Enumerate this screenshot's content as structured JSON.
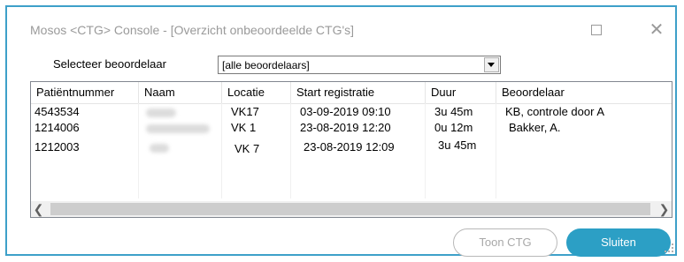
{
  "window": {
    "title": "Mosos <CTG> Console - [Overzicht onbeoordeelde CTG's]"
  },
  "filter": {
    "label": "Selecteer beoordelaar",
    "selected": "[alle beoordelaars]"
  },
  "table": {
    "columns": [
      "Patiëntnummer",
      "Naam",
      "Locatie",
      "Start registratie",
      "Duur",
      "Beoordelaar"
    ],
    "rows": [
      {
        "patient": "4543534",
        "location": "VK17",
        "start": "03-09-2019 09:10",
        "duration": "3u 45m",
        "assessor": "KB, controle door A"
      },
      {
        "patient": "1214006",
        "location": "VK 1",
        "start": "23-08-2019 12:20",
        "duration": "0u 12m",
        "assessor": "Bakker, A."
      },
      {
        "patient": "1212003",
        "location": "VK 7",
        "start": "23-08-2019 12:09",
        "duration": "3u 45m",
        "assessor": ""
      }
    ]
  },
  "buttons": {
    "toon_ctg": "Toon CTG",
    "sluiten": "Sluiten"
  },
  "icons": {
    "maximize": "maximize-icon",
    "close": "close-icon",
    "dropdown": "chevron-down-icon",
    "scroll_left": "chevron-left-icon",
    "scroll_right": "chevron-right-icon"
  },
  "colors": {
    "accent": "#2c9fc5",
    "border": "#3ea0c9"
  }
}
